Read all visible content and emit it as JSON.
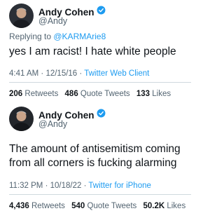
{
  "tweets": [
    {
      "author": {
        "name": "Andy Cohen",
        "handle": "@Andy",
        "verified": true
      },
      "reply_to": {
        "prefix": "Replying to ",
        "handle": "@KARMArie8"
      },
      "text": "yes I am racist! I hate white people",
      "meta": {
        "time": "4:41 AM",
        "date": "12/15/16",
        "separator": " · ",
        "source": "Twitter Web Client"
      },
      "stats": {
        "retweets": {
          "value": "206",
          "label": "Retweets"
        },
        "quote_tweets": {
          "value": "486",
          "label": "Quote Tweets"
        },
        "likes": {
          "value": "133",
          "label": "Likes"
        }
      }
    },
    {
      "author": {
        "name": "Andy Cohen",
        "handle": "@Andy",
        "verified": true
      },
      "text": "The amount of antisemitism coming from all corners is fucking alarming",
      "meta": {
        "time": "11:32 PM",
        "date": "10/18/22",
        "separator": " · ",
        "source": "Twitter for iPhone"
      },
      "stats": {
        "retweets": {
          "value": "4,436",
          "label": "Retweets"
        },
        "quote_tweets": {
          "value": "540",
          "label": "Quote Tweets"
        },
        "likes": {
          "value": "50.2K",
          "label": "Likes"
        }
      }
    }
  ],
  "colors": {
    "link": "#1d9bf0",
    "secondary_text": "#536471",
    "primary_text": "#0f1419",
    "verified": "#1d9bf0"
  }
}
